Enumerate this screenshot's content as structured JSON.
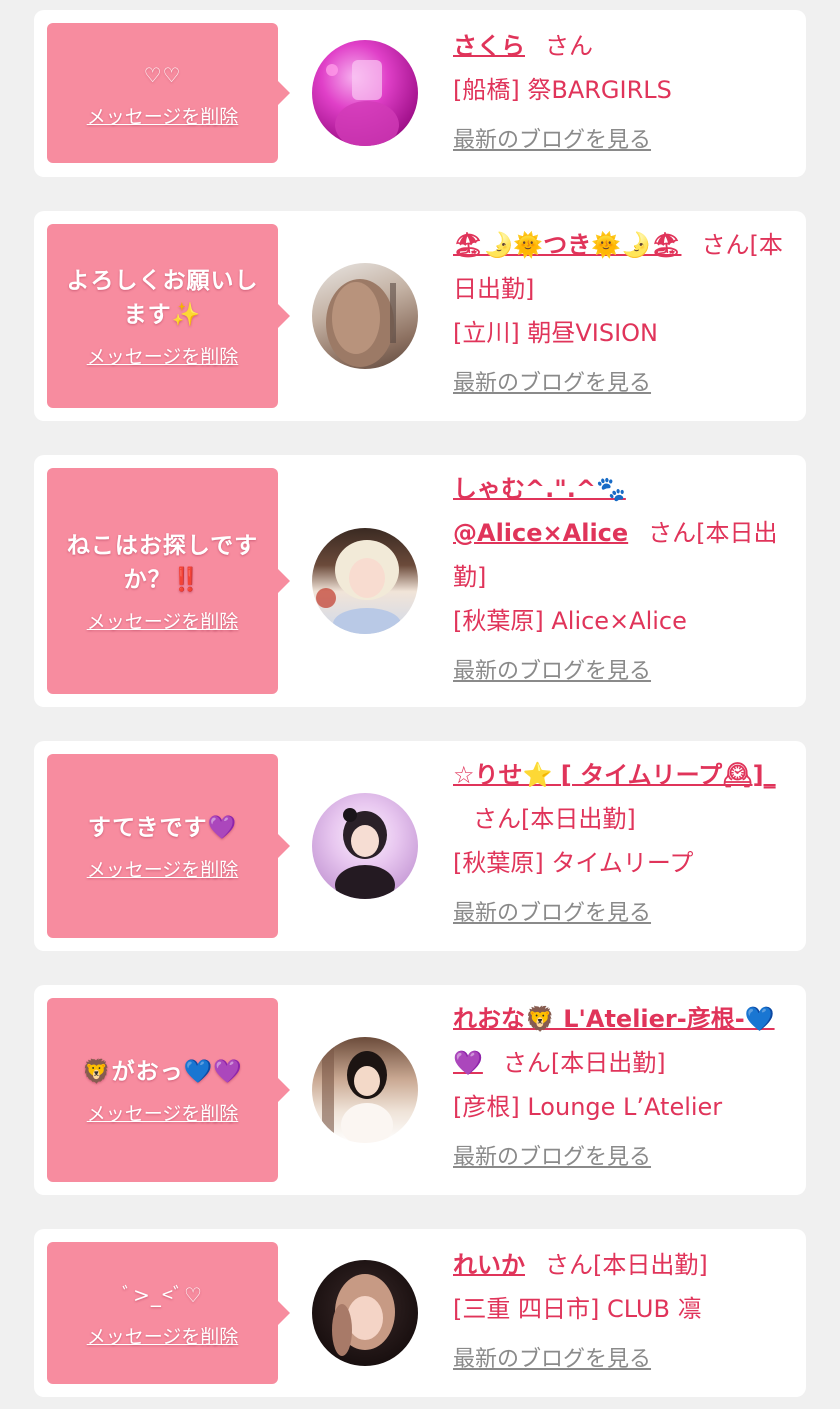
{
  "colors": {
    "page_bg": "#f0f0f0",
    "card_bg": "#ffffff",
    "bubble_bg": "#f78c9f",
    "accent": "#e0345a",
    "muted_link": "#8a8a8a"
  },
  "common": {
    "delete_label": "メッセージを削除",
    "blog_label": "最新のブログを見る",
    "honorific": "さん"
  },
  "items": [
    {
      "message": "♡♡",
      "cast_name": "さくら",
      "status": "",
      "shop": "[船橋] 祭BARGIRLS"
    },
    {
      "message": "よろしくお願いします✨",
      "cast_name": "🏖🌛🌞つき🌞🌛🏖",
      "status": "[本日出勤]",
      "shop": "[立川] 朝昼VISION"
    },
    {
      "message": "ねこはお探しですか？‼️",
      "cast_name": "しゃむ^.\".^🐾@Alice×Alice",
      "status": "[本日出勤]",
      "shop": "[秋葉原] Alice×Alice"
    },
    {
      "message": "すてきです💜",
      "cast_name": "☆りせ⭐ [ タイムリープ🕰]_",
      "status": "[本日出勤]",
      "shop": "[秋葉原] タイムリープ"
    },
    {
      "message": "🦁がおっ💙💜",
      "cast_name": "れおな🦁 L'Atelier-彦根-💙💜",
      "status": "[本日出勤]",
      "shop": "[彦根] Lounge L’Atelier"
    },
    {
      "message": "ﾞ>_<ﾞ♡",
      "cast_name": "れいか",
      "status": "[本日出勤]",
      "shop": "[三重 四日市] CLUB 凛"
    }
  ]
}
